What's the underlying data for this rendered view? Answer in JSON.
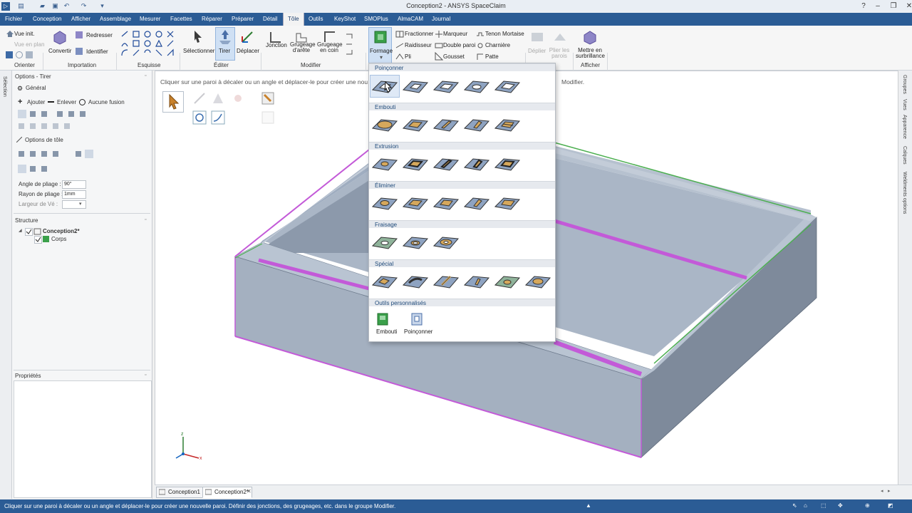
{
  "app": {
    "window_title": "Conception2 - ANSYS SpaceClaim",
    "window_controls": {
      "minimize_icon": "minimize-icon",
      "maximize_icon": "maximize-icon",
      "close_icon": "close-icon",
      "min": "‒",
      "max": "❐",
      "close": "✕"
    }
  },
  "menu": {
    "items": [
      "Fichier",
      "Conception",
      "Afficher",
      "Assemblage",
      "Mesurer",
      "Facettes",
      "Réparer",
      "Préparer",
      "Détail",
      "Tôle",
      "Outils",
      "KeyShot",
      "SMOPlus",
      "AlmaCAM",
      "Journal"
    ],
    "active": "Tôle"
  },
  "ribbon": {
    "orienter": {
      "vue_init": "Vue init.",
      "vue_en_plan": "Vue en plan",
      "group_label": "Orienter"
    },
    "importation": {
      "convertir": "Convertir",
      "redresser": "Redresser",
      "identifier": "Identifier",
      "group_label": "Importation"
    },
    "esquisse": {
      "group_label": "Esquisse"
    },
    "editer": {
      "selectionner": "Sélectionner",
      "tirer": "Tirer",
      "deplacer": "Déplacer",
      "group_label": "Éditer"
    },
    "modifier": {
      "jonction": "Jonction",
      "grugeage_arete": "Grugeage d'arête",
      "grugeage_coin": "Grugeage en coin",
      "group_label": "Modifier"
    },
    "formage": {
      "formage": "Formage",
      "fractionner": "Fractionner",
      "marqueur": "Marqueur",
      "tenon_mortaise": "Tenon Mortaise",
      "raidisseur": "Raidisseur",
      "double_paroi": "Double paroi",
      "charniere": "Charnière",
      "pli": "Pli",
      "gousset": "Gousset",
      "patte": "Patte"
    },
    "deplier": {
      "deplier": "Déplier",
      "plier_les_parois": "Plier les parois"
    },
    "afficher": {
      "mettre_en_surbrillance": "Mettre en surbrillance",
      "group_label": "Afficher"
    }
  },
  "left_strip": {
    "label": "Sélection"
  },
  "options_panel": {
    "title": "Options - Tirer",
    "general": "Général",
    "ajouter": "Ajouter",
    "enlever": "Enlever",
    "aucune_fusion": "Aucune fusion",
    "options_tole": "Options de tôle",
    "angle_label": "Angle de pliage :",
    "angle_value": "90°",
    "rayon_label": "Rayon de pliage :",
    "rayon_value": "1mm",
    "largeur_label": "Largeur de Vé :",
    "largeur_value": ""
  },
  "structure": {
    "title": "Structure",
    "root": "Conception2*",
    "child": "Corps"
  },
  "properties": {
    "title": "Propriétés"
  },
  "viewport": {
    "hint": "Cliquer sur une paroi à décaler ou un angle et déplacer-le pour créer une nou",
    "hint_tail": "Modifier.",
    "axes": {
      "z": "z",
      "x": "x"
    },
    "colors": {
      "face": "#a9b6c8",
      "edge_highlight": "#c35ad8",
      "green_edge": "#4caf50"
    }
  },
  "right_strip": {
    "labels": [
      "Groupes",
      "Vues",
      "Apparence",
      "Calques",
      "Weldments options"
    ]
  },
  "gallery": {
    "sections": [
      {
        "label": "Poinçonner",
        "count": 5
      },
      {
        "label": "Embouti",
        "count": 5
      },
      {
        "label": "Extrusion",
        "count": 5
      },
      {
        "label": "Éliminer",
        "count": 5
      },
      {
        "label": "Fraisage",
        "count": 3
      },
      {
        "label": "Spécial",
        "count": 6
      }
    ],
    "custom_label": "Outils personnalisés",
    "custom_items": [
      "Embouti",
      "Poinçonner"
    ],
    "tile_color": "#8ea3c1",
    "feature_color": "#d6a85c"
  },
  "doc_tabs": [
    "Conception1",
    "Conception2*"
  ],
  "status": {
    "text": "Cliquer sur une paroi à décaler ou un angle et déplacer-le pour créer une nouvelle paroi.  Définir des jonctions, des grugeages, etc. dans le groupe Modifier."
  }
}
